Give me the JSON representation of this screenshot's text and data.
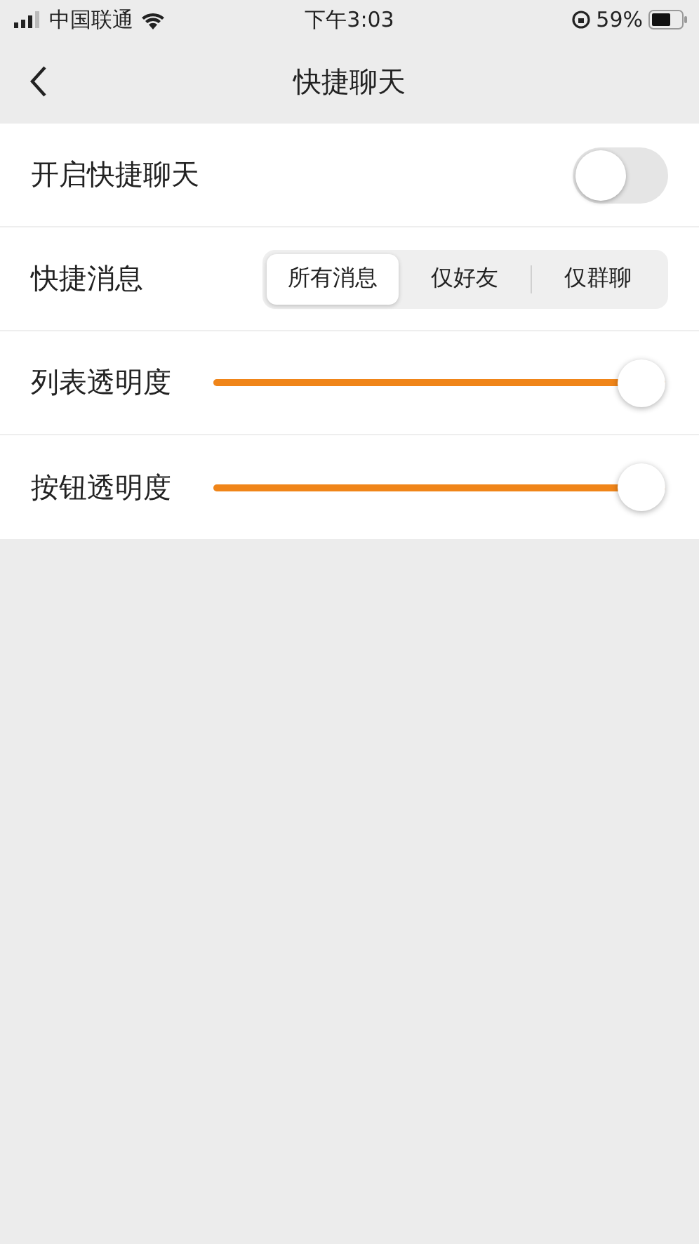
{
  "status_bar": {
    "carrier": "中国联通",
    "time": "下午3:03",
    "battery": "59%"
  },
  "nav": {
    "title": "快捷聊天"
  },
  "rows": [
    {
      "kind": "toggle",
      "label": "开启快捷聊天",
      "on": false
    },
    {
      "kind": "segmented",
      "label": "快捷消息",
      "options": [
        {
          "label": "所有消息",
          "selected": true
        },
        {
          "label": "仅好友",
          "selected": false
        },
        {
          "label": "仅群聊",
          "selected": false
        }
      ]
    },
    {
      "kind": "slider",
      "label": "列表透明度",
      "level": 1
    },
    {
      "kind": "slider",
      "label": "按钮透明度",
      "level": 1
    }
  ]
}
